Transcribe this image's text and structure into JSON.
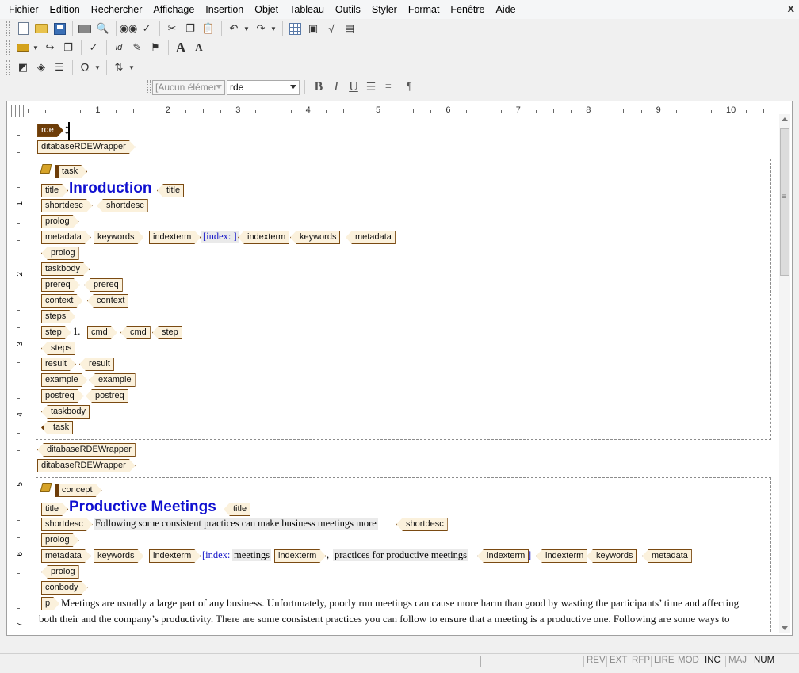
{
  "menu": [
    "Fichier",
    "Edition",
    "Rechercher",
    "Affichage",
    "Insertion",
    "Objet",
    "Tableau",
    "Outils",
    "Styler",
    "Format",
    "Fenêtre",
    "Aide"
  ],
  "close_glyph": "x",
  "format_bar": {
    "style_combo": "[Aucun élémer",
    "element_combo": "rde",
    "bold": "B",
    "italic": "I",
    "underline": "U",
    "pilcrow": "¶"
  },
  "ruler": {
    "h_numbers": [
      "1",
      "2",
      "3",
      "4",
      "5",
      "6",
      "7",
      "8",
      "9",
      "10"
    ],
    "v_numbers": [
      "1",
      "2",
      "3",
      "4",
      "5",
      "6",
      "7"
    ]
  },
  "doc": {
    "rde": "rde",
    "wrapper": "ditabaseRDEWrapper",
    "task": {
      "tag": "task",
      "title_tag": "title",
      "title_text": "Inroduction",
      "shortdesc": "shortdesc",
      "prolog": "prolog",
      "metadata": "metadata",
      "keywords": "keywords",
      "indexterm": "indexterm",
      "index_text": "[index: ]",
      "taskbody": "taskbody",
      "prereq": "prereq",
      "context": "context",
      "steps": "steps",
      "step": "step",
      "step_num": "1.",
      "cmd": "cmd",
      "result": "result",
      "example": "example",
      "postreq": "postreq"
    },
    "concept": {
      "tag": "concept",
      "title_tag": "title",
      "title_text": "Productive Meetings",
      "shortdesc_tag": "shortdesc",
      "shortdesc_text": "Following some consistent practices can make business meetings more",
      "prolog": "prolog",
      "metadata": "metadata",
      "keywords": "keywords",
      "indexterm": "indexterm",
      "index_open": "[index:",
      "index_term1": "meetings",
      "index_comma": ",",
      "index_term2": "practices for productive meetings",
      "index_close": "]",
      "conbody": "conbody",
      "p_tag": "p",
      "p_line1": "Meetings are usually a large part of any business. Unfortunately, poorly run meetings can cause more harm than good by wasting the participants’ time and affecting",
      "p_line2": "both their and the company’s productivity. There are some consistent practices you can follow to ensure that a meeting is a productive one. Following are some ways to"
    }
  },
  "status": {
    "indicators": [
      {
        "label": "REV",
        "on": false
      },
      {
        "label": "EXT",
        "on": false
      },
      {
        "label": "RFP",
        "on": false
      },
      {
        "label": "LIRE",
        "on": false
      },
      {
        "label": "MOD",
        "on": false
      },
      {
        "label": "INC",
        "on": true
      },
      {
        "label": "MAJ",
        "on": false
      },
      {
        "label": "NUM",
        "on": true
      }
    ]
  }
}
